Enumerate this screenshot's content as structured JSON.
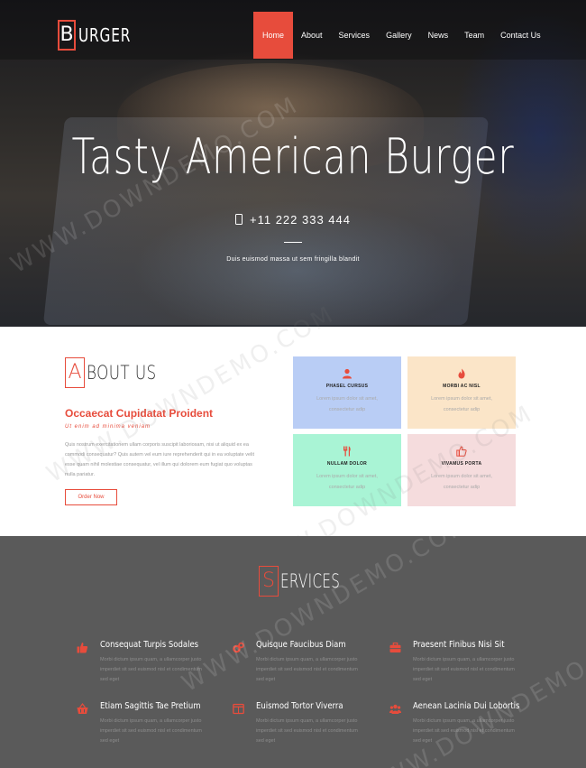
{
  "brand": {
    "logo_letter": "B",
    "logo_rest": "URGER"
  },
  "nav": {
    "items": [
      "Home",
      "About",
      "Services",
      "Gallery",
      "News",
      "Team",
      "Contact Us"
    ],
    "active": "Home"
  },
  "hero": {
    "title": "Tasty American Burger",
    "phone": "+11 222 333 444",
    "subtitle": "Duis euismod massa ut sem fringilla blandit"
  },
  "about": {
    "heading_letter": "A",
    "heading_rest": "BOUT US",
    "title": "Occaecat Cupidatat Proident",
    "subtitle": "Ut enim ad minima veniam",
    "body": "Quis nostrum exercitationem ullam corporis suscipit laboriosam, nisi ut aliquid ex ea commodi consequatur? Quis autem vel eum iure reprehenderit qui in ea voluptate velit esse quam nihil molestiae consequatur, vel illum qui dolorem eum fugiat quo voluptas nulla pariatur.",
    "button": "Order Now",
    "features": [
      {
        "title": "PHASEL CURSUS",
        "text": "Lorem ipsum dolor sit amet, consectetur adip",
        "icon": "user-icon",
        "bg": "#b9cdf5"
      },
      {
        "title": "MORBI AC NISL",
        "text": "Lorem ipsum dolor sit amet, consectetur adip",
        "icon": "fire-icon",
        "bg": "#fbe5c8"
      },
      {
        "title": "NULLAM DOLOR",
        "text": "Lorem ipsum dolor sit amet, consectetur adip",
        "icon": "cutlery-icon",
        "bg": "#a9f4d5"
      },
      {
        "title": "VIVAMUS PORTA",
        "text": "Lorem ipsum dolor sit amet, consectetur adip",
        "icon": "thumbs-up-icon",
        "bg": "#f5dcdd"
      }
    ]
  },
  "services": {
    "heading_letter": "S",
    "heading_rest": "ERVICES",
    "items": [
      {
        "title": "Consequat Turpis Sodales",
        "text": "Morbi dictum ipsum quam, a ullamcorper justo imperdiet sit sed euismod nisl et condimentum sed eget",
        "icon": "thumbs-up-icon"
      },
      {
        "title": "Quisque Faucibus Diam",
        "text": "Morbi dictum ipsum quam, a ullamcorper justo imperdiet sit sed euismod nisl et condimentum sed eget",
        "icon": "gears-icon"
      },
      {
        "title": "Praesent Finibus Nisi Sit",
        "text": "Morbi dictum ipsum quam, a ullamcorper justo imperdiet sit sed euismod nisl et condimentum sed eget",
        "icon": "briefcase-icon"
      },
      {
        "title": "Etiam Sagittis Tae Pretium",
        "text": "Morbi dictum ipsum quam, a ullamcorper justo imperdiet sit sed euismod nisl et condimentum sed eget",
        "icon": "basket-icon"
      },
      {
        "title": "Euismod Tortor Viverra",
        "text": "Morbi dictum ipsum quam, a ullamcorper justo imperdiet sit sed euismod nisl et condimentum sed eget",
        "icon": "window-icon"
      },
      {
        "title": "Aenean Lacinia Dui Lobortis",
        "text": "Morbi dictum ipsum quam, a ullamcorper justo imperdiet sit sed euismod nisl et condimentum sed eget",
        "icon": "group-icon"
      }
    ]
  },
  "watermark": "WWW.DOWNDEMO.COM",
  "colors": {
    "accent": "#e74c3c",
    "services_bg": "#5a5a5a"
  }
}
